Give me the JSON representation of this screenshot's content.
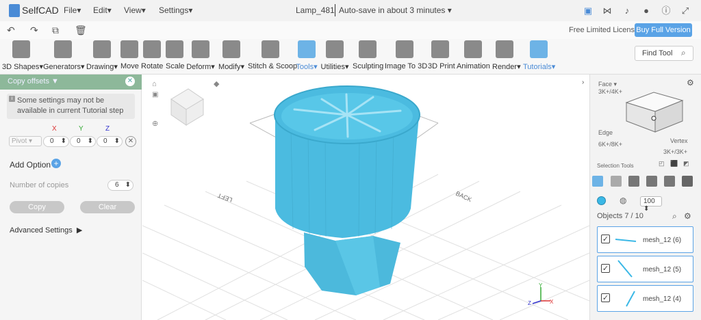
{
  "app": {
    "name": "SelfCAD"
  },
  "menu": {
    "file": "File",
    "edit": "Edit",
    "view": "View",
    "settings": "Settings"
  },
  "document": {
    "title": "Lamp_481",
    "autosave": "Auto-save in about 3 minutes"
  },
  "license": {
    "text": "Free Limited License",
    "buy": "Buy Full Version"
  },
  "tools": [
    {
      "label": "3D Shapes"
    },
    {
      "label": "Generators"
    },
    {
      "label": "Drawing"
    },
    {
      "label": "Move"
    },
    {
      "label": "Rotate"
    },
    {
      "label": "Scale"
    },
    {
      "label": "Deform"
    },
    {
      "label": "Modify"
    },
    {
      "label": "Stitch & Scoop"
    },
    {
      "label": "Tools"
    },
    {
      "label": "Utilities"
    },
    {
      "label": "Sculpting"
    },
    {
      "label": "Image To 3D"
    },
    {
      "label": "3D Print"
    },
    {
      "label": "Animation"
    },
    {
      "label": "Render"
    },
    {
      "label": "Tutorials"
    }
  ],
  "find_tool": {
    "placeholder": "Find Tool"
  },
  "left_panel": {
    "title": "Copy offsets",
    "note": "Some settings may not be available in current Tutorial step",
    "axes": {
      "x": "X",
      "y": "Y",
      "z": "Z"
    },
    "pivot": "Pivot",
    "values": {
      "x": "0",
      "y": "0",
      "z": "0"
    },
    "add_option": "Add Option",
    "num_copies_label": "Number of copies",
    "num_copies": "6",
    "copy": "Copy",
    "clear": "Clear",
    "advanced": "Advanced Settings"
  },
  "viewport": {
    "left_label": "LEFT",
    "back_label": "BACK"
  },
  "right_panel": {
    "face": "Face",
    "face_count": "3K+/4K+",
    "edge": "Edge",
    "edge_count": "6K+/8K+",
    "vertex": "Vertex",
    "vertex_count": "3K+/3K+",
    "selection_tools": "Selection Tools",
    "size": "100",
    "objects": "Objects 7 / 10",
    "items": [
      {
        "name": "mesh_12 (6)"
      },
      {
        "name": "mesh_12 (5)"
      },
      {
        "name": "mesh_12 (4)"
      }
    ]
  }
}
